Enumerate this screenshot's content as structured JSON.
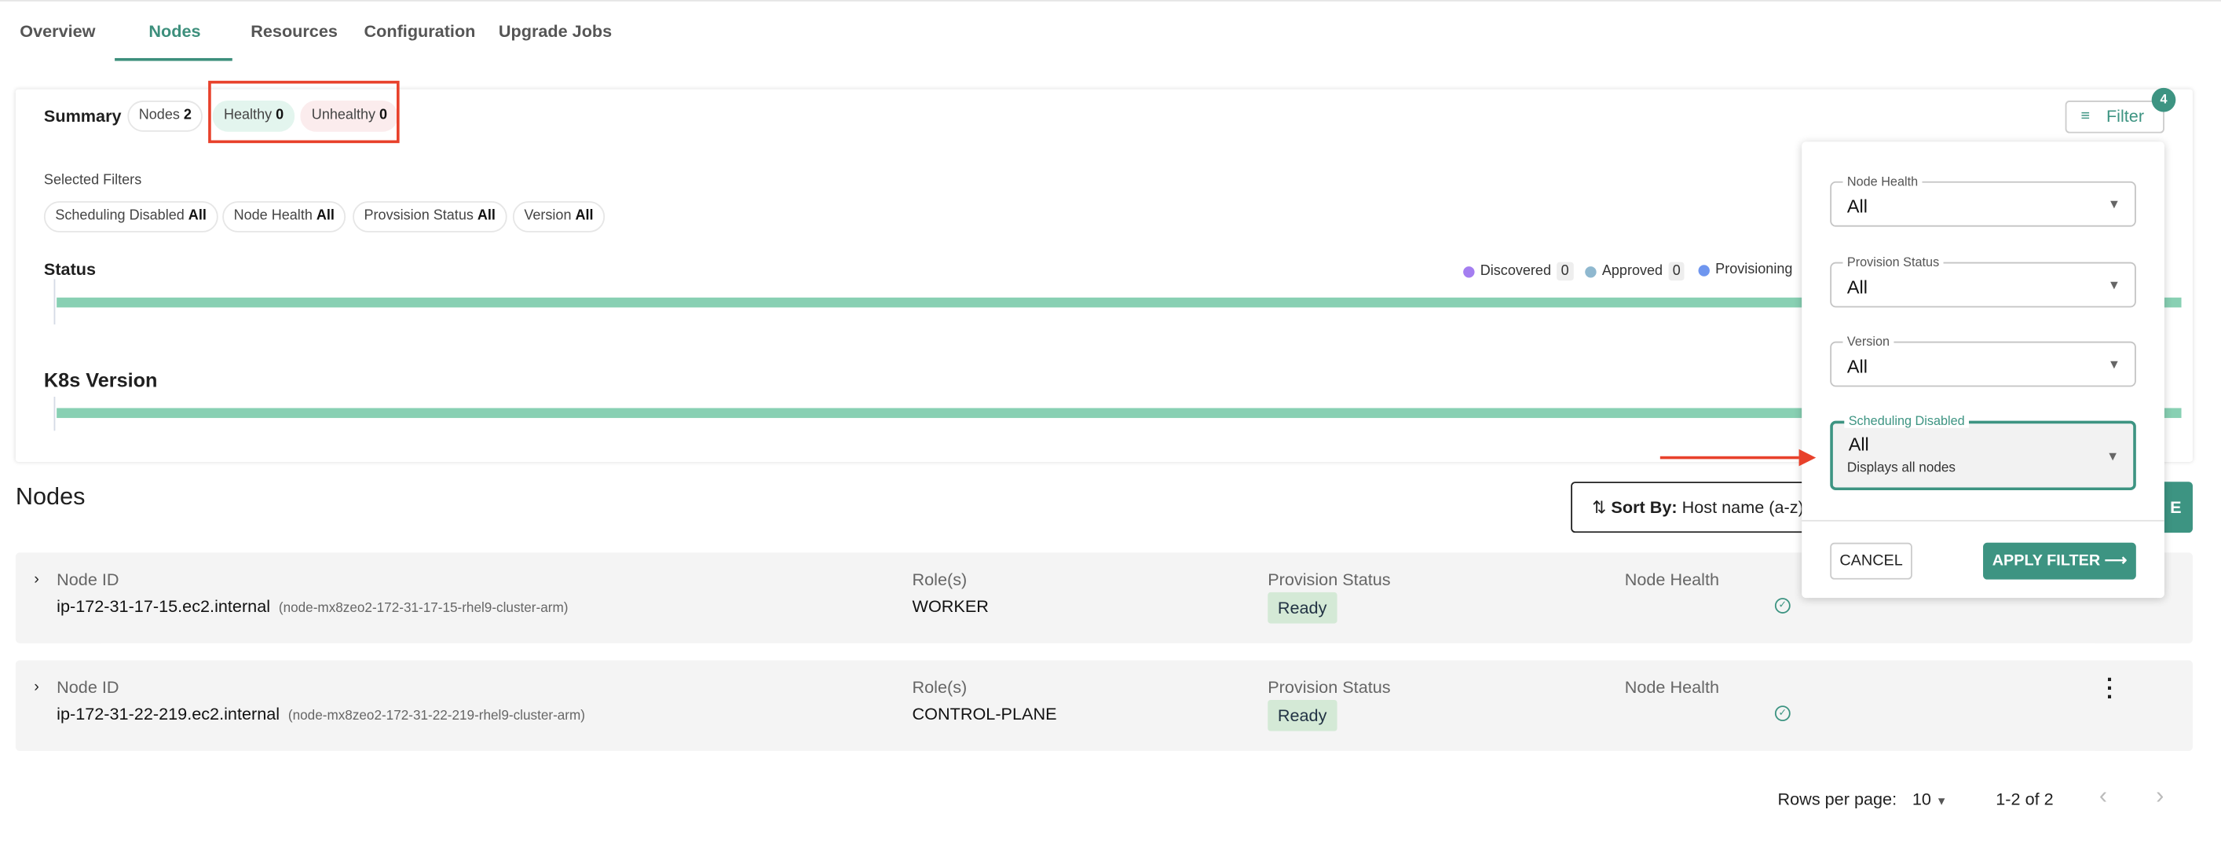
{
  "tabs": [
    {
      "label": "Overview"
    },
    {
      "label": "Nodes",
      "active": true
    },
    {
      "label": "Resources"
    },
    {
      "label": "Configuration"
    },
    {
      "label": "Upgrade Jobs"
    }
  ],
  "summary": {
    "title": "Summary",
    "chips": [
      {
        "label": "Nodes",
        "value": "2"
      },
      {
        "label": "Healthy",
        "value": "0"
      },
      {
        "label": "Unhealthy",
        "value": "0"
      }
    ]
  },
  "selected_filters": {
    "title": "Selected Filters",
    "chips": [
      {
        "label": "Scheduling Disabled",
        "value": "All"
      },
      {
        "label": "Node Health",
        "value": "All"
      },
      {
        "label": "Provsision Status",
        "value": "All"
      },
      {
        "label": "Version",
        "value": "All"
      }
    ]
  },
  "status": {
    "title": "Status",
    "legend": [
      {
        "label": "Discovered",
        "count": "0",
        "color": "#a47ef0"
      },
      {
        "label": "Approved",
        "count": "0",
        "color": "#8fb8cf"
      },
      {
        "label": "Provisioning",
        "color": "#6f96ef"
      }
    ]
  },
  "k8s": {
    "title": "K8s Version"
  },
  "filter_button": {
    "label": "Filter",
    "badge": "4"
  },
  "filter_panel": {
    "fields": [
      {
        "label": "Node Health",
        "value": "All"
      },
      {
        "label": "Provision Status",
        "value": "All"
      },
      {
        "label": "Version",
        "value": "All"
      },
      {
        "label": "Scheduling Disabled",
        "value": "All",
        "helper": "Displays all nodes"
      }
    ],
    "cancel": "CANCEL",
    "apply": "APPLY FILTER"
  },
  "nodes": {
    "title": "Nodes",
    "sort_label": "Sort By:",
    "sort_value": "Host name (a-z)",
    "action_partial": "E",
    "columns": {
      "id": "Node ID",
      "roles": "Role(s)",
      "provision": "Provision Status",
      "health": "Node Health"
    },
    "rows": [
      {
        "host": "ip-172-31-17-15.ec2.internal",
        "node": "(node-mx8zeo2-172-31-17-15-rhel9-cluster-arm)",
        "role": "WORKER",
        "status": "Ready"
      },
      {
        "host": "ip-172-31-22-219.ec2.internal",
        "node": "(node-mx8zeo2-172-31-22-219-rhel9-cluster-arm)",
        "role": "CONTROL-PLANE",
        "status": "Ready"
      }
    ]
  },
  "pagination": {
    "rows_label": "Rows per page:",
    "rows_value": "10",
    "range": "1-2 of 2"
  },
  "colors": {
    "accent": "#3d9482",
    "annotation": "#e8412b"
  }
}
